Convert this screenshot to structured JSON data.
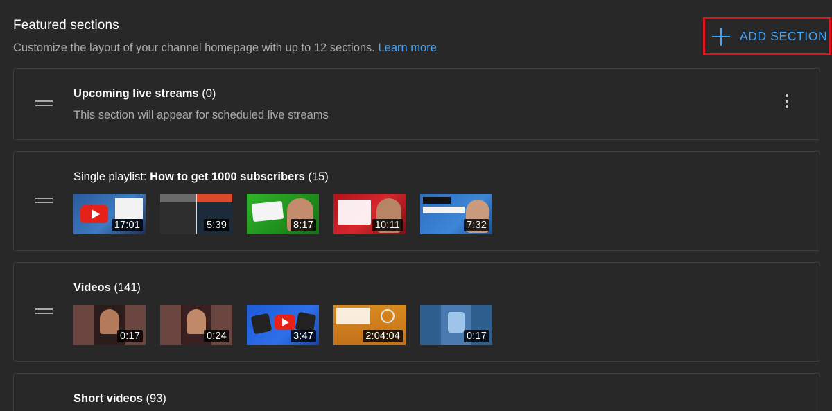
{
  "header": {
    "title": "Featured sections",
    "subtitle": "Customize the layout of your channel homepage with up to 12 sections.",
    "learn_more": "Learn more"
  },
  "add_section": {
    "label": "ADD SECTION",
    "icon": "plus-icon"
  },
  "sections": [
    {
      "title": "Upcoming live streams",
      "count": "(0)",
      "description": "This section will appear for scheduled live streams"
    },
    {
      "prefix": "Single playlist: ",
      "title": "How to get 1000 subscribers",
      "count": "(15)",
      "durations": [
        "17:01",
        "5:39",
        "8:17",
        "10:11",
        "7:32"
      ]
    },
    {
      "title": "Videos",
      "count": "(141)",
      "durations": [
        "0:17",
        "0:24",
        "3:47",
        "2:04:04",
        "0:17"
      ]
    },
    {
      "title": "Short videos",
      "count": "(93)"
    }
  ],
  "colors": {
    "background": "#282828",
    "accent": "#3ea6ff",
    "highlight": "#e0141c"
  }
}
